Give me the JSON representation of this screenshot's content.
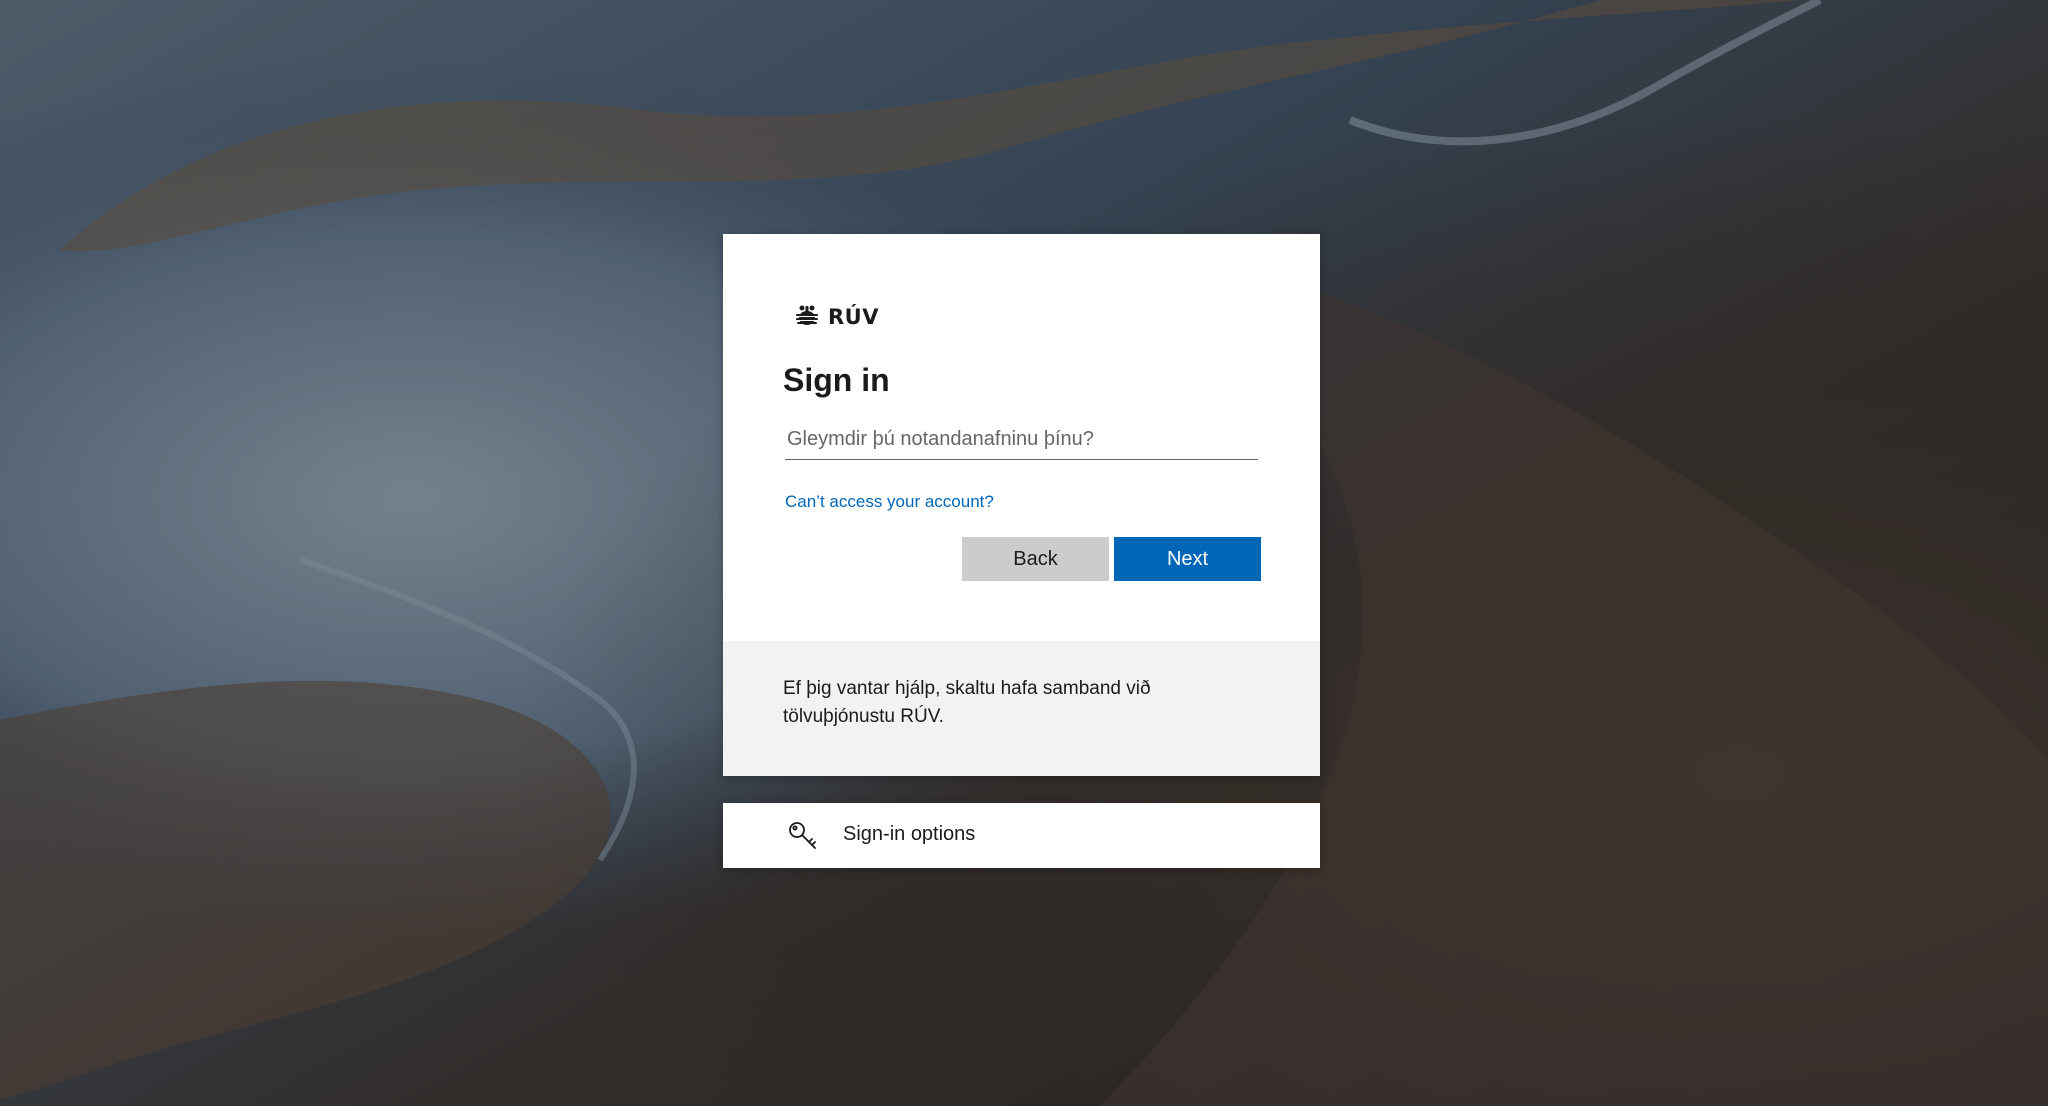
{
  "brand": {
    "name": "RÚV",
    "emblem_icon": "ruv-emblem-icon"
  },
  "signin": {
    "title": "Sign in",
    "username_placeholder": "Gleymdir þú notandanafninu þínu?",
    "username_value": "",
    "help_link": "Can’t access your account?",
    "back_label": "Back",
    "next_label": "Next"
  },
  "footer": {
    "help_text": "Ef þig vantar hjálp, skaltu hafa samband við tölvuþjónustu RÚV."
  },
  "options": {
    "label": "Sign-in options",
    "icon": "key-icon"
  },
  "colors": {
    "accent": "#0067b8",
    "back_button": "#cccccc",
    "footer_bg": "#f2f2f2"
  }
}
